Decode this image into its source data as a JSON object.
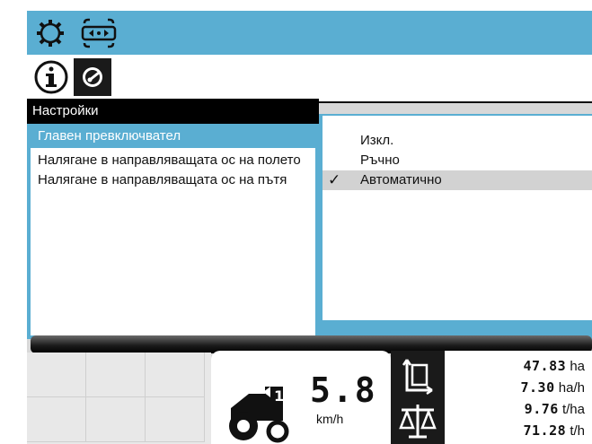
{
  "topbar": {
    "icons": [
      "gear-outline-icon",
      "axle-steering-icon"
    ]
  },
  "tabs": [
    {
      "icon": "info-icon",
      "active": false
    },
    {
      "icon": "gauge-icon",
      "active": true
    }
  ],
  "settings": {
    "title": "Настройки",
    "items": [
      {
        "label": "Главен превключвател",
        "selected": true
      },
      {
        "label": "Налягане в направляващата ос на полето",
        "selected": false
      },
      {
        "label": "Налягане в направляващата ос на пътя",
        "selected": false
      }
    ]
  },
  "options": {
    "items": [
      {
        "label": "Изкл.",
        "checked": false
      },
      {
        "label": "Ръчно",
        "checked": false
      },
      {
        "label": "Автоматично",
        "checked": true
      }
    ],
    "check_glyph": "✓"
  },
  "status": {
    "speed_value": "5.8",
    "speed_unit": "km/h",
    "gear_badge": "1",
    "stats": [
      {
        "value": "47.83",
        "unit": "ha"
      },
      {
        "value": "7.30",
        "unit": "ha/h"
      },
      {
        "value": "9.76",
        "unit": "t/ha"
      },
      {
        "value": "71.28",
        "unit": "t/h"
      }
    ]
  },
  "colors": {
    "accent": "#5aaed2",
    "panel_dark": "#1a1a1a",
    "background": "#d8d8d8"
  }
}
